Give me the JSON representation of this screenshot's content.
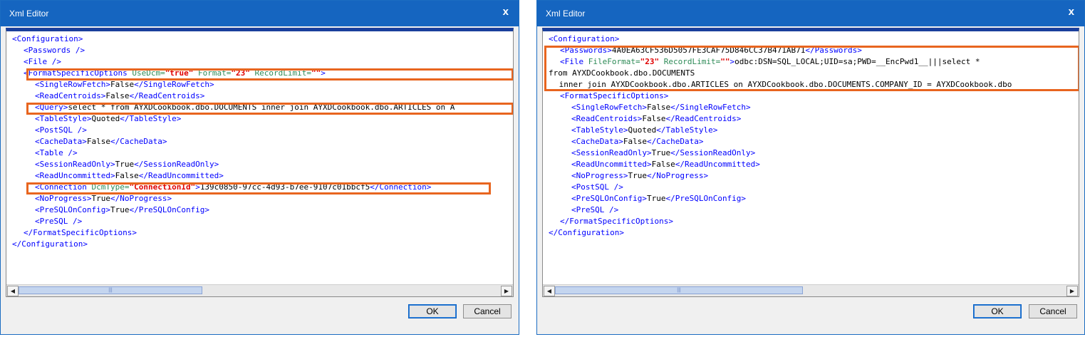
{
  "dialogs": [
    {
      "title": "Xml Editor",
      "close_glyph": "x",
      "ok_label": "OK",
      "cancel_label": "Cancel",
      "lines": [
        [
          {
            "t": "tag",
            "v": "<Configuration>"
          }
        ],
        [
          {
            "t": "tag",
            "v": "<Passwords />"
          }
        ],
        [
          {
            "t": "tag",
            "v": "<File />"
          }
        ],
        [
          {
            "t": "tag",
            "v": "<FormatSpecificOptions "
          },
          {
            "t": "an",
            "v": "UseDcm="
          },
          {
            "t": "av",
            "v": "\"true\""
          },
          {
            "t": "an",
            "v": " Format="
          },
          {
            "t": "av",
            "v": "\"23\""
          },
          {
            "t": "an",
            "v": " RecordLimit="
          },
          {
            "t": "av",
            "v": "\"\""
          },
          {
            "t": "tag",
            "v": ">"
          }
        ],
        [
          {
            "t": "tag",
            "v": "<SingleRowFetch>"
          },
          {
            "t": "txt",
            "v": "False"
          },
          {
            "t": "tag",
            "v": "</SingleRowFetch>"
          }
        ],
        [
          {
            "t": "tag",
            "v": "<ReadCentroids>"
          },
          {
            "t": "txt",
            "v": "False"
          },
          {
            "t": "tag",
            "v": "</ReadCentroids>"
          }
        ],
        [
          {
            "t": "tag",
            "v": "<Query>"
          },
          {
            "t": "txt",
            "v": "select * from AYXDCookbook.dbo.DOCUMENTS inner join AYXDCookbook.dbo.ARTICLES on A"
          }
        ],
        [
          {
            "t": "tag",
            "v": "<TableStyle>"
          },
          {
            "t": "txt",
            "v": "Quoted"
          },
          {
            "t": "tag",
            "v": "</TableStyle>"
          }
        ],
        [
          {
            "t": "tag",
            "v": "<PostSQL />"
          }
        ],
        [
          {
            "t": "tag",
            "v": "<CacheData>"
          },
          {
            "t": "txt",
            "v": "False"
          },
          {
            "t": "tag",
            "v": "</CacheData>"
          }
        ],
        [
          {
            "t": "tag",
            "v": "<Table />"
          }
        ],
        [
          {
            "t": "tag",
            "v": "<SessionReadOnly>"
          },
          {
            "t": "txt",
            "v": "True"
          },
          {
            "t": "tag",
            "v": "</SessionReadOnly>"
          }
        ],
        [
          {
            "t": "tag",
            "v": "<ReadUncommitted>"
          },
          {
            "t": "txt",
            "v": "False"
          },
          {
            "t": "tag",
            "v": "</ReadUncommitted>"
          }
        ],
        [
          {
            "t": "tag",
            "v": "<Connection "
          },
          {
            "t": "an",
            "v": "DcmType="
          },
          {
            "t": "av",
            "v": "\"ConnectionId\""
          },
          {
            "t": "tag",
            "v": ">"
          },
          {
            "t": "txt",
            "v": "139c0850-97cc-4d93-b7ee-9107c01bbcf5"
          },
          {
            "t": "tag",
            "v": "</Connection>"
          }
        ],
        [
          {
            "t": "tag",
            "v": "<NoProgress>"
          },
          {
            "t": "txt",
            "v": "True"
          },
          {
            "t": "tag",
            "v": "</NoProgress>"
          }
        ],
        [
          {
            "t": "tag",
            "v": "<PreSQLOnConfig>"
          },
          {
            "t": "txt",
            "v": "True"
          },
          {
            "t": "tag",
            "v": "</PreSQLOnConfig>"
          }
        ],
        [
          {
            "t": "tag",
            "v": "<PreSQL />"
          }
        ],
        [
          {
            "t": "tag",
            "v": "</FormatSpecificOptions>"
          }
        ],
        [
          {
            "t": "tag",
            "v": "</Configuration>"
          }
        ]
      ]
    },
    {
      "title": "Xml Editor",
      "close_glyph": "x",
      "ok_label": "OK",
      "cancel_label": "Cancel",
      "lines": [
        [
          {
            "t": "tag",
            "v": "<Configuration>"
          }
        ],
        [
          {
            "t": "tag",
            "v": "<Passwords>"
          },
          {
            "t": "txt",
            "v": "4A0EA63CF536D5057FE3CAF75D846CC37B471AB71"
          },
          {
            "t": "tag",
            "v": "</Passwords>"
          }
        ],
        [
          {
            "t": "tag",
            "v": "<File "
          },
          {
            "t": "an",
            "v": "FileFormat="
          },
          {
            "t": "av",
            "v": "\"23\""
          },
          {
            "t": "an",
            "v": " RecordLimit="
          },
          {
            "t": "av",
            "v": "\"\""
          },
          {
            "t": "tag",
            "v": ">"
          },
          {
            "t": "txt",
            "v": "odbc:DSN=SQL_LOCAL;UID=sa;PWD=__EncPwd1__|||select *"
          }
        ],
        [
          {
            "t": "txt",
            "v": "from AYXDCookbook.dbo.DOCUMENTS"
          }
        ],
        [
          {
            "t": "txt",
            "v": " inner join AYXDCookbook.dbo.ARTICLES on AYXDCookbook.dbo.DOCUMENTS.COMPANY_ID = AYXDCookbook.dbo"
          }
        ],
        [
          {
            "t": "tag",
            "v": "<FormatSpecificOptions>"
          }
        ],
        [
          {
            "t": "tag",
            "v": "<SingleRowFetch>"
          },
          {
            "t": "txt",
            "v": "False"
          },
          {
            "t": "tag",
            "v": "</SingleRowFetch>"
          }
        ],
        [
          {
            "t": "tag",
            "v": "<ReadCentroids>"
          },
          {
            "t": "txt",
            "v": "False"
          },
          {
            "t": "tag",
            "v": "</ReadCentroids>"
          }
        ],
        [
          {
            "t": "tag",
            "v": "<TableStyle>"
          },
          {
            "t": "txt",
            "v": "Quoted"
          },
          {
            "t": "tag",
            "v": "</TableStyle>"
          }
        ],
        [
          {
            "t": "tag",
            "v": "<CacheData>"
          },
          {
            "t": "txt",
            "v": "False"
          },
          {
            "t": "tag",
            "v": "</CacheData>"
          }
        ],
        [
          {
            "t": "tag",
            "v": "<SessionReadOnly>"
          },
          {
            "t": "txt",
            "v": "True"
          },
          {
            "t": "tag",
            "v": "</SessionReadOnly>"
          }
        ],
        [
          {
            "t": "tag",
            "v": "<ReadUncommitted>"
          },
          {
            "t": "txt",
            "v": "False"
          },
          {
            "t": "tag",
            "v": "</ReadUncommitted>"
          }
        ],
        [
          {
            "t": "tag",
            "v": "<NoProgress>"
          },
          {
            "t": "txt",
            "v": "True"
          },
          {
            "t": "tag",
            "v": "</NoProgress>"
          }
        ],
        [
          {
            "t": "tag",
            "v": "<PostSQL />"
          }
        ],
        [
          {
            "t": "tag",
            "v": "<PreSQLOnConfig>"
          },
          {
            "t": "txt",
            "v": "True"
          },
          {
            "t": "tag",
            "v": "</PreSQLOnConfig>"
          }
        ],
        [
          {
            "t": "tag",
            "v": "<PreSQL />"
          }
        ],
        [
          {
            "t": "tag",
            "v": "</FormatSpecificOptions>"
          }
        ],
        [
          {
            "t": "tag",
            "v": "</Configuration>"
          }
        ]
      ]
    }
  ],
  "colors": {
    "titlebar": "#1565c0",
    "tag": "#0000ff",
    "attribute_name": "#2e8b57",
    "attribute_value": "#e00000",
    "highlight": "#e8651f"
  }
}
